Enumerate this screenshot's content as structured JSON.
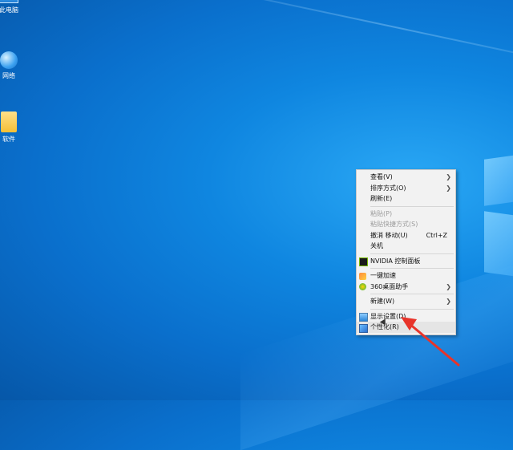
{
  "desktop": {
    "icons": [
      {
        "label": "此电脑",
        "icon": "computer-icon"
      },
      {
        "label": "网络",
        "icon": "network-icon"
      },
      {
        "label": "软件",
        "icon": "folder-icon"
      }
    ]
  },
  "context_menu": {
    "items": [
      {
        "label": "查看(V)",
        "submenu": true
      },
      {
        "label": "排序方式(O)",
        "submenu": true
      },
      {
        "label": "刷新(E)"
      },
      {
        "label": "粘贴(P)",
        "disabled": true
      },
      {
        "label": "粘贴快捷方式(S)",
        "disabled": true
      },
      {
        "label": "撤消 移动(U)",
        "shortcut": "Ctrl+Z"
      },
      {
        "label": "关机"
      },
      {
        "label": "NVIDIA 控制面板",
        "icon": "nvidia-icon"
      },
      {
        "label": "一键加速",
        "icon": "boost-icon"
      },
      {
        "label": "360桌面助手",
        "icon": "360-icon",
        "submenu": true
      },
      {
        "label": "新建(W)",
        "submenu": true
      },
      {
        "label": "显示设置(D)",
        "icon": "display-icon"
      },
      {
        "label": "个性化(R)",
        "icon": "personalize-icon",
        "highlighted": true
      }
    ]
  },
  "colors": {
    "annotation_arrow": "#e8342a",
    "menu_bg": "#f2f2f2"
  }
}
